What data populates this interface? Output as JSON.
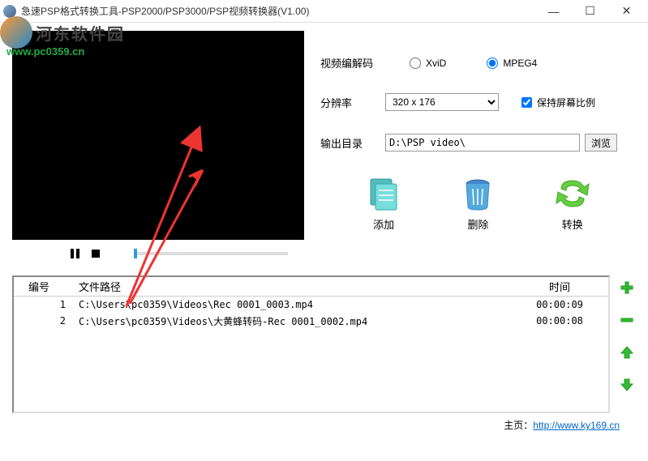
{
  "window": {
    "title": "急速PSP格式转换工具-PSP2000/PSP3000/PSP视频转换器(V1.00)"
  },
  "watermark": {
    "brand": "河东软件园",
    "url": "www.pc0359.cn"
  },
  "settings": {
    "codec_label": "视频编解码",
    "codec_opt1": "XviD",
    "codec_opt2": "MPEG4",
    "resolution_label": "分辨率",
    "resolution_value": "320 x 176",
    "keep_ratio_label": "保持屏幕比例",
    "output_label": "输出目录",
    "output_path": "D:\\PSP video\\",
    "browse_label": "浏览"
  },
  "actions": {
    "add": "添加",
    "delete": "删除",
    "convert": "转换"
  },
  "filelist": {
    "header_num": "编号",
    "header_path": "文件路径",
    "header_time": "时间",
    "rows": [
      {
        "num": "1",
        "path": "C:\\Users\\pc0359\\Videos\\Rec 0001_0003.mp4",
        "time": "00:00:09"
      },
      {
        "num": "2",
        "path": "C:\\Users\\pc0359\\Videos\\大黄蜂转码-Rec 0001_0002.mp4",
        "time": "00:00:08"
      }
    ]
  },
  "footer": {
    "label": "主页：",
    "url": "http://www.ky169.cn"
  }
}
